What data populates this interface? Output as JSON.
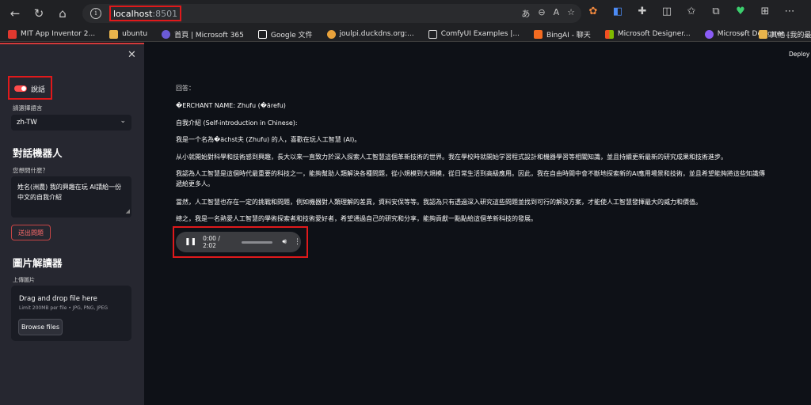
{
  "browser": {
    "url_host": "localhost",
    "url_port": ":8501",
    "bookmarks": [
      {
        "label": "MIT App Inventor 2...",
        "color": "#e0382f"
      },
      {
        "label": "ubuntu",
        "color": "#e9b44c"
      },
      {
        "label": "首頁 | Microsoft 365",
        "color": "#6b5bd6"
      },
      {
        "label": "Google 文件",
        "color": "#ffffff"
      },
      {
        "label": "joulpi.duckdns.org:...",
        "color": "#e9a23b"
      },
      {
        "label": "ComfyUI Examples |...",
        "color": "#dcdcdc"
      },
      {
        "label": "BingAI - 聊天",
        "color": "#f36b21"
      },
      {
        "label": "Microsoft Designer...",
        "color": "#f25022"
      },
      {
        "label": "Microsoft Designer...",
        "color": "#8a5cf6"
      }
    ],
    "other_bookmarks": "其他 [我的最"
  },
  "sidebar": {
    "toggle_label": "說話",
    "toggle_on": true,
    "lang_label": "請選擇語言",
    "lang_value": "zh-TW",
    "chat_title": "對話機器人",
    "ask_label": "您想問什麼？",
    "ask_value": "姓名(洲農) 我的興趣在玩 AI請給一份中文的自我介紹",
    "send_label": "送出問題",
    "image_title": "圖片解讀器",
    "upload_label": "上傳圖片",
    "dropzone_title": "Drag and drop file here",
    "dropzone_limit": "Limit 200MB per file • JPG, PNG, JPEG",
    "browse_label": "Browse files"
  },
  "main": {
    "deploy_label": "Deploy",
    "answer_lines": [
      "回答：",
      "�ERCHANT NAME: Zhufu (�ārefu)",
      "自我介紹 (Self-introduction in Chinese):",
      "我是一个名為�ächst夫 (Zhufu) 的人，喜歡在玩人工智慧 (AI)。",
      "从小就開始對科學和技術感到興趣，長大以来一直致力於深入探索人工智慧這個革新技術的世界。我在學校時就開始学習程式設計和機器學習等相關知識，並且持續更新最新的研究成果和技術進步。",
      "我認為人工智慧是這個時代最重要的科技之一，能夠幫助人類解決各種問題，從小規模到大規模，從日常生活到高級應用。因此，我在自由時間中會不斷地探索新的AI應用場景和技術，並且希望能夠將這些知識傳",
      "遞給更多人。",
      "當然，人工智慧也存在一定的挑戰和問題，例如機器對人類理解的差異，資料安保等等。我認為只有透過深入研究這些問題並找到可行的解決方案，才能使人工智慧發揮最大的威力和價值。",
      "總之，我是一名熱愛人工智慧的學術探索者和技術愛好者，希望通過自己的研究和分享，能夠貢獻一點點給這個革新科技的發展。"
    ],
    "audio": {
      "time": "0:00 / 2:02",
      "progress_fraction": 0.0
    }
  }
}
